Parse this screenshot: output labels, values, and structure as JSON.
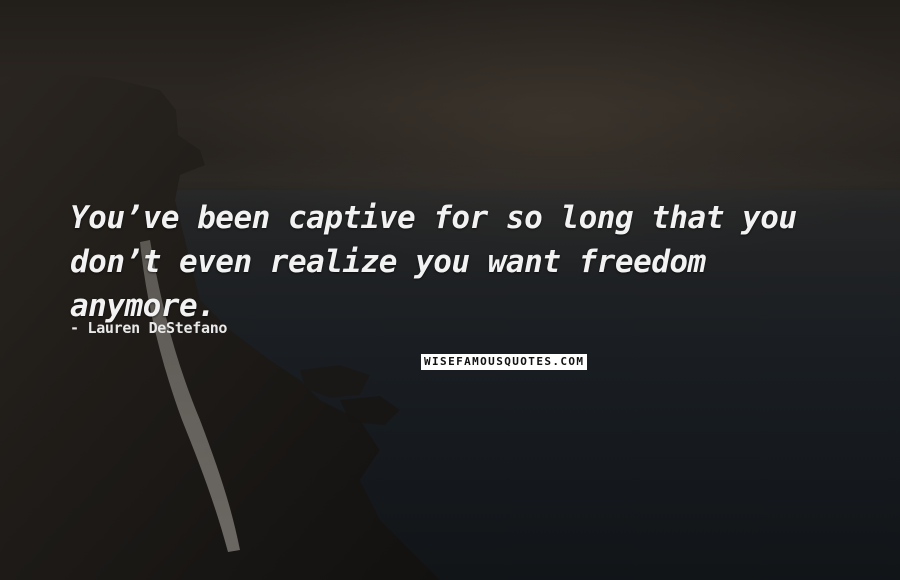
{
  "quote": {
    "text": "You’ve been captive for so long that you don’t even realize you want freedom anymore."
  },
  "author": {
    "text": "- Lauren DeStefano"
  },
  "watermark": {
    "text": "WISEFAMOUSQUOTES.COM"
  },
  "colors": {
    "text": "#f2f2f2",
    "watermark_bg": "#ffffff",
    "watermark_text": "#111111",
    "background": "#1a1714"
  }
}
